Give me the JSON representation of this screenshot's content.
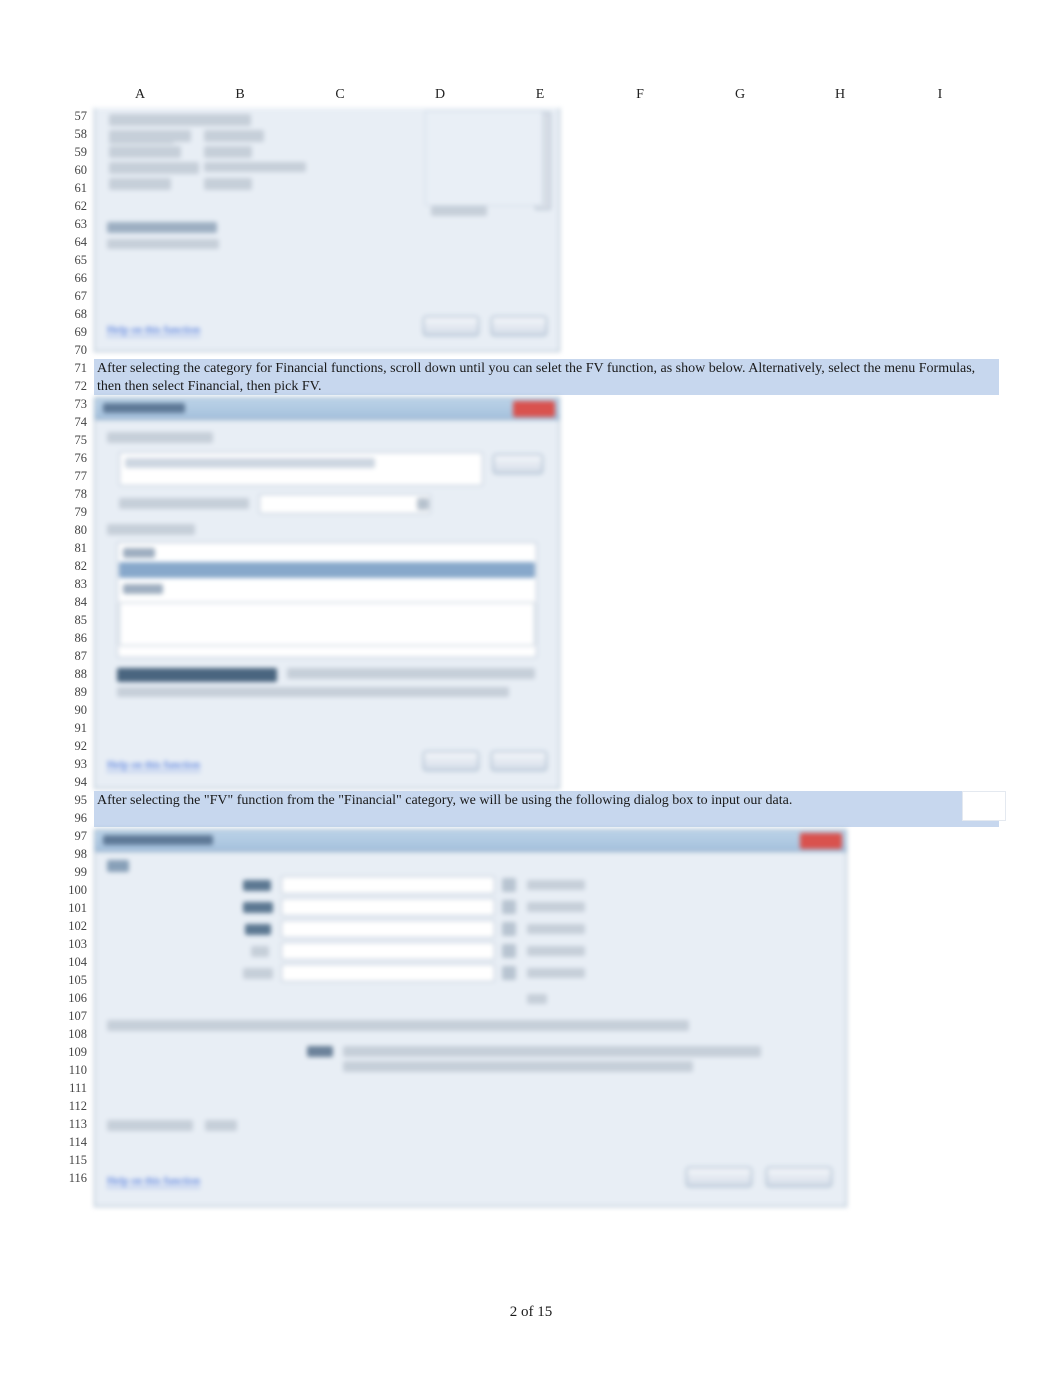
{
  "columns": [
    "A",
    "B",
    "C",
    "D",
    "E",
    "F",
    "G",
    "H",
    "I"
  ],
  "row_start": 57,
  "row_end": 116,
  "rows_with_highlight": [
    71,
    72,
    95
  ],
  "text": {
    "r71_72": "After selecting the category for Financial functions, scroll down until you can selet the FV function, as show below. Alternatively, select the menu Formulas, then then select Financial, then pick FV.",
    "r95": "After selecting the \"FV\" function from the \"Financial\" category, we will be using the following dialog box to input our data."
  },
  "footer": {
    "page": "2 of 15"
  },
  "dialog1": {
    "link": "Help on this function",
    "buttons": [
      "OK",
      "Cancel"
    ]
  },
  "dialog2": {
    "title": "Insert Function",
    "search_label": "Search for a function:",
    "select_label": "Or select a category:",
    "category_value": "Financial",
    "list_label": "Select a function:",
    "list_selected": "FV",
    "description": "FV(rate,nper,pmt,pv,type) Returns the future value of an investment based on periodic, constant payments and a constant interest rate.",
    "link": "Help on this function",
    "buttons": [
      "OK",
      "Cancel"
    ]
  },
  "dialog3": {
    "title": "Function Arguments",
    "fn": "FV",
    "args": [
      "Rate",
      "Nper",
      "Pmt",
      "Pv",
      "Type"
    ],
    "formula_result_label": "Formula result =",
    "formula_result_value": "$0.00",
    "link": "Help on this function",
    "buttons": [
      "OK",
      "Cancel"
    ]
  }
}
